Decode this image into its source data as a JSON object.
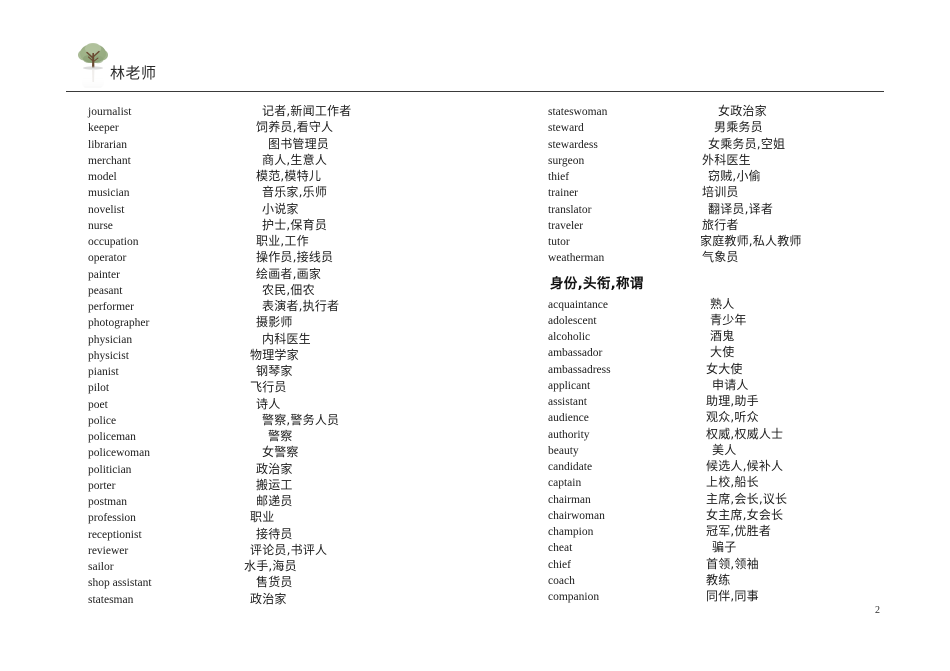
{
  "document": {
    "site_title": "林老师",
    "logo_icon": "tree-icon",
    "page_number": "2"
  },
  "columns": {
    "left": {
      "entries": [
        {
          "term": "journalist",
          "def": "记者,新闻工作者",
          "indent": 14
        },
        {
          "term": "keeper",
          "def": "饲养员,看守人",
          "indent": 8
        },
        {
          "term": "librarian",
          "def": "图书管理员",
          "indent": 20
        },
        {
          "term": "merchant",
          "def": "商人,生意人",
          "indent": 14
        },
        {
          "term": "model",
          "def": "模范,模特儿",
          "indent": 8
        },
        {
          "term": "musician",
          "def": "音乐家,乐师",
          "indent": 14
        },
        {
          "term": "novelist",
          "def": "小说家",
          "indent": 14
        },
        {
          "term": "nurse",
          "def": "护士,保育员",
          "indent": 14
        },
        {
          "term": "occupation",
          "def": "职业,工作",
          "indent": 8
        },
        {
          "term": "operator",
          "def": "操作员,接线员",
          "indent": 8
        },
        {
          "term": "painter",
          "def": "绘画者,画家",
          "indent": 8
        },
        {
          "term": "peasant",
          "def": "农民,佃农",
          "indent": 14
        },
        {
          "term": "performer",
          "def": "表演者,执行者",
          "indent": 14
        },
        {
          "term": "photographer",
          "def": "摄影师",
          "indent": 8
        },
        {
          "term": "physician",
          "def": "内科医生",
          "indent": 14
        },
        {
          "term": "physicist",
          "def": "物理学家",
          "indent": 2
        },
        {
          "term": "pianist",
          "def": "钢琴家",
          "indent": 8
        },
        {
          "term": "pilot",
          "def": "飞行员",
          "indent": 2
        },
        {
          "term": "poet",
          "def": "诗人",
          "indent": 8
        },
        {
          "term": "police",
          "def": "警察,警务人员",
          "indent": 14
        },
        {
          "term": "policeman",
          "def": "警察",
          "indent": 20
        },
        {
          "term": "policewoman",
          "def": "女警察",
          "indent": 14
        },
        {
          "term": "politician",
          "def": "政治家",
          "indent": 8
        },
        {
          "term": "porter",
          "def": "搬运工",
          "indent": 8
        },
        {
          "term": "postman",
          "def": "邮递员",
          "indent": 8
        },
        {
          "term": "profession",
          "def": "职业",
          "indent": 2
        },
        {
          "term": "receptionist",
          "def": "接待员",
          "indent": 8
        },
        {
          "term": "reviewer",
          "def": "评论员,书评人",
          "indent": 2
        },
        {
          "term": "sailor",
          "def": "水手,海员",
          "indent": -4
        },
        {
          "term": "shop assistant",
          "def": "售货员",
          "indent": 8
        },
        {
          "term": "statesman",
          "def": "政治家",
          "indent": 2
        }
      ]
    },
    "right": {
      "entries_top": [
        {
          "term": "stateswoman",
          "def": "女政治家",
          "indent": 18
        },
        {
          "term": "steward",
          "def": "男乘务员",
          "indent": 14
        },
        {
          "term": "stewardess",
          "def": "女乘务员,空姐",
          "indent": 8
        },
        {
          "term": "surgeon",
          "def": "外科医生",
          "indent": 2
        },
        {
          "term": "thief",
          "def": "窃贼,小偷",
          "indent": 8
        },
        {
          "term": "trainer",
          "def": "培训员",
          "indent": 2
        },
        {
          "term": "translator",
          "def": "翻译员,译者",
          "indent": 8
        },
        {
          "term": "traveler",
          "def": "旅行者",
          "indent": 2
        },
        {
          "term": "tutor",
          "def": "家庭教师,私人教师",
          "indent": 0
        },
        {
          "term": "weatherman",
          "def": "气象员",
          "indent": 2
        }
      ],
      "section_heading": "身份,头衔,称谓",
      "entries_bottom": [
        {
          "term": "acquaintance",
          "def": "熟人",
          "indent": 10
        },
        {
          "term": "adolescent",
          "def": "青少年",
          "indent": 10
        },
        {
          "term": "alcoholic",
          "def": "酒鬼",
          "indent": 10
        },
        {
          "term": "ambassador",
          "def": "大使",
          "indent": 10
        },
        {
          "term": "ambassadress",
          "def": "女大使",
          "indent": 6
        },
        {
          "term": "applicant",
          "def": "申请人",
          "indent": 12
        },
        {
          "term": "assistant",
          "def": "助理,助手",
          "indent": 6
        },
        {
          "term": "audience",
          "def": "观众,听众",
          "indent": 6
        },
        {
          "term": "authority",
          "def": "权威,权威人士",
          "indent": 6
        },
        {
          "term": "beauty",
          "def": "美人",
          "indent": 12
        },
        {
          "term": "candidate",
          "def": "候选人,候补人",
          "indent": 6
        },
        {
          "term": "captain",
          "def": "上校,船长",
          "indent": 6
        },
        {
          "term": "chairman",
          "def": "主席,会长,议长",
          "indent": 6
        },
        {
          "term": "chairwoman",
          "def": "女主席,女会长",
          "indent": 6
        },
        {
          "term": "champion",
          "def": "冠军,优胜者",
          "indent": 6
        },
        {
          "term": "cheat",
          "def": "骗子",
          "indent": 12
        },
        {
          "term": "chief",
          "def": "首领,领袖",
          "indent": 6
        },
        {
          "term": "coach",
          "def": "教练",
          "indent": 6
        },
        {
          "term": "companion",
          "def": "同伴,同事",
          "indent": 6
        }
      ]
    }
  }
}
